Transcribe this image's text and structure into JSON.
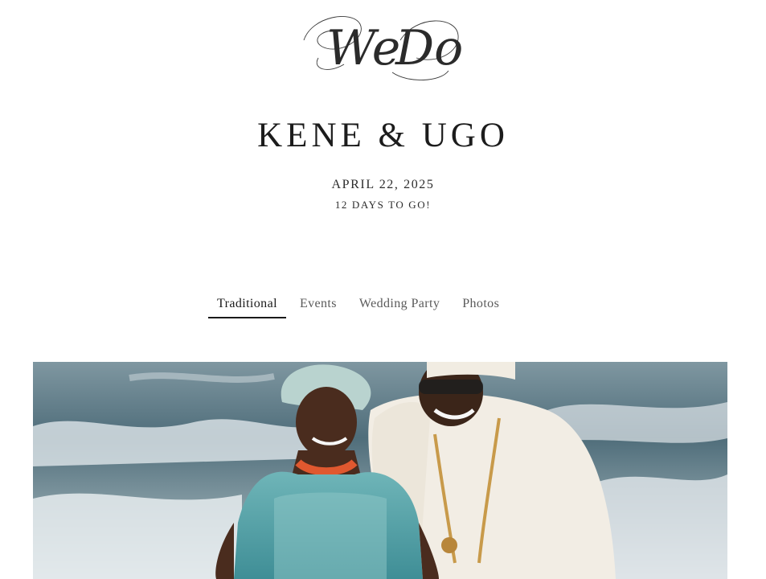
{
  "logo": {
    "text_left": "We",
    "text_right": "Do"
  },
  "header": {
    "couple_names": "KENE & UGO",
    "date": "APRIL 22, 2025",
    "countdown": "12 DAYS TO GO!"
  },
  "nav": {
    "tabs": [
      {
        "label": "Traditional",
        "active": true
      },
      {
        "label": "Events",
        "active": false
      },
      {
        "label": "Wedding Party",
        "active": false
      },
      {
        "label": "Photos",
        "active": false
      }
    ]
  },
  "colors": {
    "text_primary": "#1a1a1a",
    "text_muted": "#5a5a5a",
    "active_underline": "#1a1a1a",
    "sea": "#4f6d7a",
    "foam": "#dfe6ea"
  }
}
